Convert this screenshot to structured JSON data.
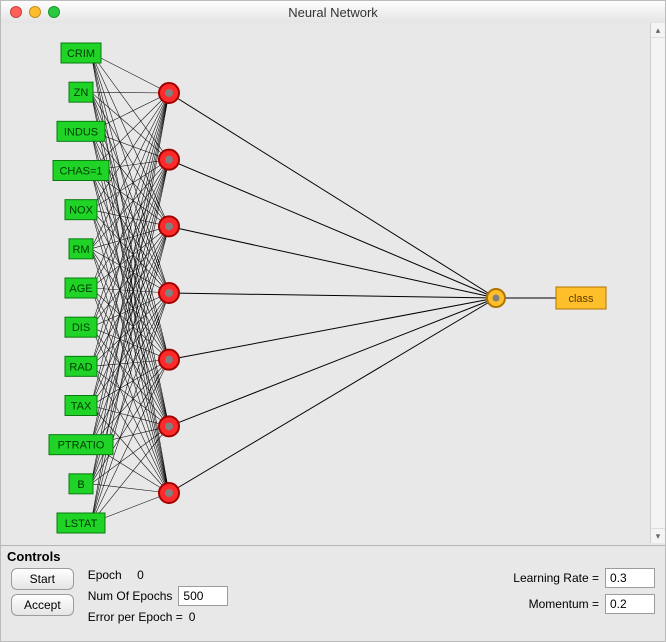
{
  "window": {
    "title": "Neural Network"
  },
  "network": {
    "input_nodes": [
      {
        "label": "CRIM"
      },
      {
        "label": "ZN"
      },
      {
        "label": "INDUS"
      },
      {
        "label": "CHAS=1"
      },
      {
        "label": "NOX"
      },
      {
        "label": "RM"
      },
      {
        "label": "AGE"
      },
      {
        "label": "DIS"
      },
      {
        "label": "RAD"
      },
      {
        "label": "TAX"
      },
      {
        "label": "PTRATIO"
      },
      {
        "label": "B"
      },
      {
        "label": "LSTAT"
      }
    ],
    "hidden_count": 7,
    "aggregator_count": 1,
    "output_node": {
      "label": "class"
    },
    "colors": {
      "input_fill": "#1fd426",
      "input_stroke": "#0a7a10",
      "hidden_fill": "#ff2a2a",
      "hidden_stroke": "#a00000",
      "hidden_core": "#808080",
      "agg_fill": "#ffbf2b",
      "agg_stroke": "#b07500",
      "agg_core": "#808080",
      "output_fill": "#ffbf2b",
      "output_stroke": "#b07500",
      "edge": "#000000"
    }
  },
  "controls": {
    "panel_title": "Controls",
    "start_label": "Start",
    "accept_label": "Accept",
    "epoch_label": "Epoch",
    "epoch_value": "0",
    "num_epochs_label": "Num Of Epochs",
    "num_epochs_value": "500",
    "error_label": "Error per Epoch =",
    "error_value": "0",
    "learning_rate_label": "Learning Rate =",
    "learning_rate_value": "0.3",
    "momentum_label": "Momentum =",
    "momentum_value": "0.2"
  }
}
